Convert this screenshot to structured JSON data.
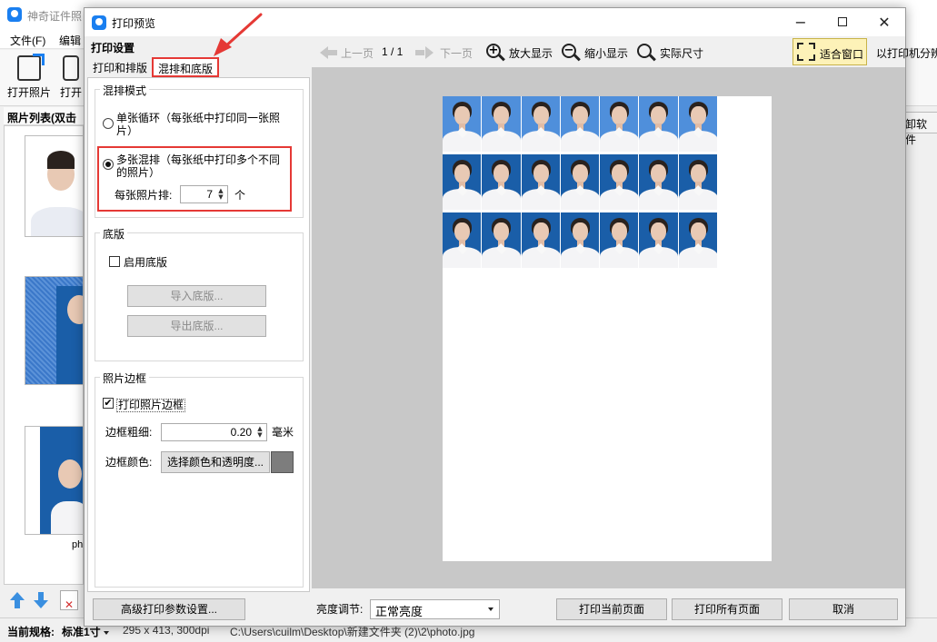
{
  "background_app": {
    "title": "神奇证件照",
    "menu": [
      "文件(F)",
      "编辑"
    ],
    "toolbar": [
      "打开照片",
      "打开"
    ],
    "sidebar_title": "照片列表(双击打",
    "thumb_label": "ph",
    "right_panel_tab": "卸软件",
    "status": {
      "spec_label": "当前规格:",
      "spec_value": "标准1寸",
      "size": "295 x 413, 300dpi",
      "path": "C:\\Users\\cuilm\\Desktop\\新建文件夹 (2)\\2\\photo.jpg"
    }
  },
  "dialog": {
    "title": "打印预览",
    "settings_heading": "打印设置",
    "tabs": [
      {
        "label": "打印和排版",
        "active": false
      },
      {
        "label": "混排和底版",
        "active": true
      }
    ],
    "mix_mode": {
      "title": "混排模式",
      "option_single_line1": "单张循环（每张纸中打印同一张照",
      "option_single_line2": "片）",
      "option_multi_line1": "多张混排（每张纸中打印多个不同",
      "option_multi_line2": "的照片）",
      "selected": "multi",
      "per_photo_label": "每张照片排:",
      "per_photo_value": "7",
      "per_photo_unit": "个"
    },
    "base_plate": {
      "title": "底版",
      "enable_label": "启用底版",
      "enabled": false,
      "import_button": "导入底版...",
      "export_button": "导出底版..."
    },
    "border": {
      "title": "照片边框",
      "print_border_label": "打印照片边框",
      "print_border_checked": true,
      "thickness_label": "边框粗细:",
      "thickness_value": "0.20",
      "thickness_unit": "毫米",
      "color_label": "边框颜色:",
      "color_button": "选择颜色和透明度...",
      "color_value": "#7d7d7d"
    },
    "preview_toolbar": {
      "prev_page": "上一页",
      "page_indicator": "1 / 1",
      "next_page": "下一页",
      "zoom_in": "放大显示",
      "zoom_out": "缩小显示",
      "actual_size": "实际尺寸",
      "fit_window": "适合窗口",
      "printer_resolution": "以打印机分辨率预览"
    },
    "preview": {
      "rows": [
        {
          "bg": "#4f8fdb",
          "count": 7
        },
        {
          "bg": "#1a5ea8",
          "count": 7
        },
        {
          "bg": "#1a5ea8",
          "count": 7
        }
      ]
    },
    "bottom": {
      "advanced_button": "高级打印参数设置...",
      "brightness_label": "亮度调节:",
      "brightness_value": "正常亮度",
      "print_current": "打印当前页面",
      "print_all": "打印所有页面",
      "cancel": "取消"
    },
    "icons": {
      "min": "minimize-icon",
      "max": "maximize-icon",
      "close": "close-icon"
    },
    "accent_color": "#e53935"
  }
}
